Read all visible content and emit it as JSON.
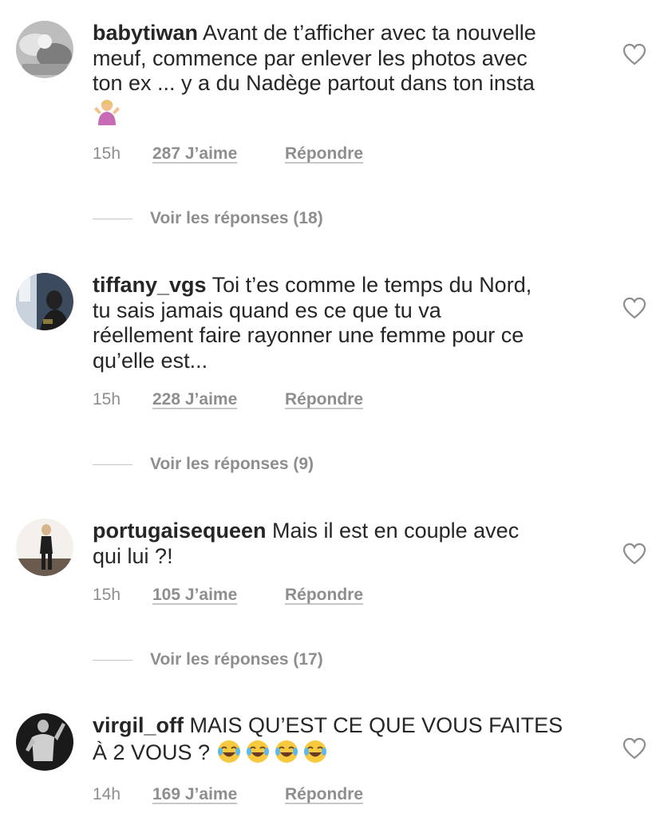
{
  "colors": {
    "text": "#262626",
    "secondary": "#8e8e8e",
    "divider": "#c7c7c7"
  },
  "comments": [
    {
      "username": "babytiwan",
      "lines": [
        "Avant de t’afficher avec ta nouvelle",
        "meuf, commence par enlever les photos avec",
        "ton ex ... y a du Nadège partout dans ton insta"
      ],
      "emoji": "🤷🏼‍♀️",
      "emoji_name": "person-shrugging-emoji",
      "time": "15h",
      "likes": "287 J’aime",
      "reply": "Répondre",
      "view_replies": "Voir les réponses (18)",
      "like_icon": "heart-outline-icon"
    },
    {
      "username": "tiffany_vgs",
      "lines": [
        "Toi t’es comme le temps du Nord,",
        "tu sais jamais quand es ce que tu va",
        "réellement faire rayonner une femme pour ce",
        "qu’elle est..."
      ],
      "time": "15h",
      "likes": "228 J’aime",
      "reply": "Répondre",
      "view_replies": "Voir les réponses (9)",
      "like_icon": "heart-outline-icon"
    },
    {
      "username": "portugaisequeen",
      "lines": [
        "Mais il est en couple avec",
        "qui lui ?!"
      ],
      "time": "15h",
      "likes": "105 J’aime",
      "reply": "Répondre",
      "view_replies": "Voir les réponses (17)",
      "like_icon": "heart-outline-icon"
    },
    {
      "username": "virgil_off",
      "lines": [
        "MAIS QU’EST CE QUE VOUS FAITES",
        "À 2 VOUS ?"
      ],
      "emoji": "😂😂😂😂",
      "emoji_name": "tears-of-joy-emoji",
      "time": "14h",
      "likes": "169 J’aime",
      "reply": "Répondre",
      "like_icon": "heart-outline-icon"
    }
  ]
}
